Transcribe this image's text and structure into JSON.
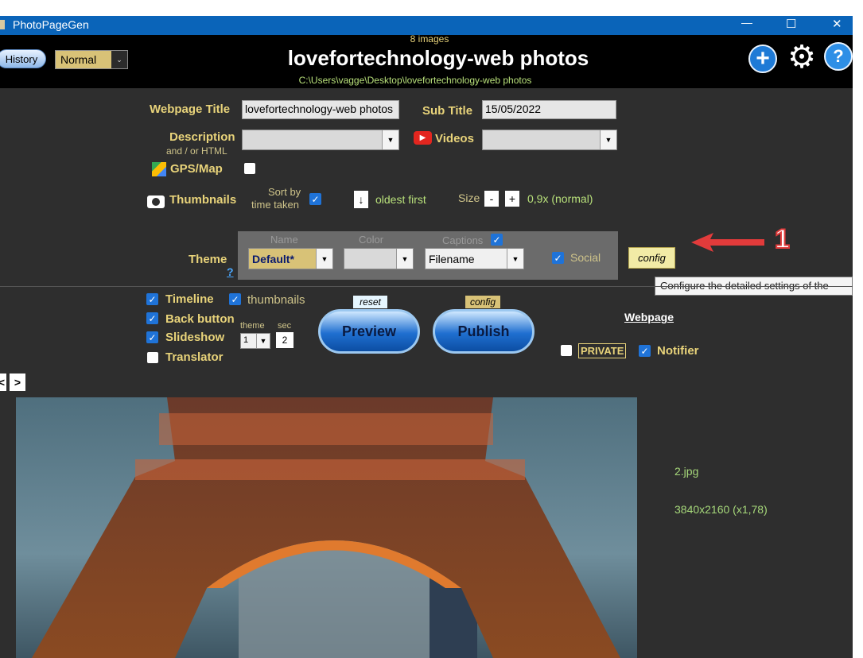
{
  "window": {
    "title": "PhotoPageGen",
    "controls": [
      "—",
      "☐",
      "✕"
    ]
  },
  "header": {
    "history_label": "History",
    "mode_value": "Normal",
    "image_count": "8 images",
    "title": "lovefortechnology-web photos",
    "path": "C:\\Users\\vagge\\Desktop\\lovefortechnology-web photos",
    "icons": [
      "plus-icon",
      "gear-icon",
      "help-icon"
    ]
  },
  "form": {
    "webpage_title_label": "Webpage Title",
    "webpage_title_value": "lovefortechnology-web photos",
    "subtitle_label": "Sub Title",
    "subtitle_value": "15/05/2022",
    "description_label": "Description",
    "description_sub": "and / or HTML",
    "videos_label": "Videos",
    "gps_label": "GPS/Map",
    "thumbnails_label": "Thumbnails",
    "sort_label_1": "Sort by",
    "sort_label_2": "time taken",
    "order_glyph": "↓",
    "oldest_first": "oldest first",
    "size_label": "Size",
    "minus": "-",
    "plus": "+",
    "size_value": "0,9x (normal)"
  },
  "theme": {
    "label": "Theme",
    "help": "?",
    "name_header": "Name",
    "color_header": "Color",
    "captions_header": "Captions",
    "name_value": "Default*",
    "captions_value": "Filename",
    "social_label": "Social",
    "config_label": "config"
  },
  "annotation": {
    "number": "1"
  },
  "tooltip": {
    "text": "Configure the detailed settings of the"
  },
  "options": {
    "timeline": "Timeline",
    "thumbnails": "thumbnails",
    "back_button": "Back button",
    "slideshow": "Slideshow",
    "translator": "Translator",
    "theme_label": "theme",
    "sec_label": "sec",
    "theme_value": "1",
    "sec_value": "2",
    "reset_label": "reset",
    "config_label": "config",
    "preview_label": "Preview",
    "publish_label": "Publish",
    "webpage_label": "Webpage",
    "private_label": "PRIVATE",
    "notifier_label": "Notifier"
  },
  "nav": {
    "prev": "<",
    "next": ">"
  },
  "image_info": {
    "filename": "2.jpg",
    "dimensions": "3840x2160 (x1,78)"
  },
  "colors": {
    "titlebar": "#0a64b9",
    "label": "#e8d37a",
    "info": "#a6d87a",
    "accent_arrow": "#e23b3b"
  }
}
